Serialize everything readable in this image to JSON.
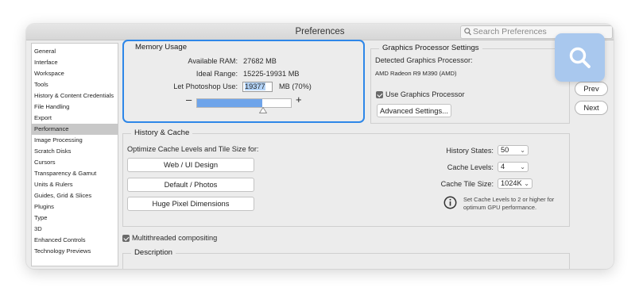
{
  "window": {
    "title": "Preferences"
  },
  "search": {
    "placeholder": "Search Preferences"
  },
  "sidebar": {
    "items": [
      {
        "label": "General"
      },
      {
        "label": "Interface"
      },
      {
        "label": "Workspace"
      },
      {
        "label": "Tools"
      },
      {
        "label": "History & Content Credentials"
      },
      {
        "label": "File Handling"
      },
      {
        "label": "Export"
      },
      {
        "label": "Performance",
        "selected": true
      },
      {
        "label": "Image Processing"
      },
      {
        "label": "Scratch Disks"
      },
      {
        "label": "Cursors"
      },
      {
        "label": "Transparency & Gamut"
      },
      {
        "label": "Units & Rulers"
      },
      {
        "label": "Guides, Grid & Slices"
      },
      {
        "label": "Plugins"
      },
      {
        "label": "Type"
      },
      {
        "label": "3D"
      },
      {
        "label": "Enhanced Controls"
      },
      {
        "label": "Technology Previews"
      }
    ]
  },
  "memory": {
    "title": "Memory Usage",
    "available_label": "Available RAM:",
    "available_value": "27682 MB",
    "ideal_label": "Ideal Range:",
    "ideal_value": "15225-19931 MB",
    "use_label": "Let Photoshop Use:",
    "use_value": "19377",
    "use_unit": "MB (70%)",
    "slider_percent": 70,
    "minus": "–",
    "plus": "+"
  },
  "gpu": {
    "title": "Graphics Processor Settings",
    "detected_label": "Detected Graphics Processor:",
    "detected_value": "AMD Radeon R9 M390 (AMD)",
    "use_gpu_label": "Use Graphics Processor",
    "use_gpu_checked": true,
    "advanced_button": "Advanced Settings..."
  },
  "history_cache": {
    "title": "History & Cache",
    "optimize_label": "Optimize Cache Levels and Tile Size for:",
    "buttons": [
      "Web / UI Design",
      "Default / Photos",
      "Huge Pixel Dimensions"
    ],
    "history_states_label": "History States:",
    "history_states_value": "50",
    "cache_levels_label": "Cache Levels:",
    "cache_levels_value": "4",
    "cache_tile_label": "Cache Tile Size:",
    "cache_tile_value": "1024K",
    "info_text_1": "Set Cache Levels to 2 or higher for",
    "info_text_2": "optimum GPU performance."
  },
  "multithreaded": {
    "label": "Multithreaded compositing",
    "checked": true
  },
  "description": {
    "title": "Description"
  },
  "side_buttons": {
    "prev": "Prev",
    "next": "Next"
  },
  "colors": {
    "accent": "#2e87e8",
    "slider_fill": "#6ea4ea",
    "zoom_badge": "#a9c8ee"
  }
}
